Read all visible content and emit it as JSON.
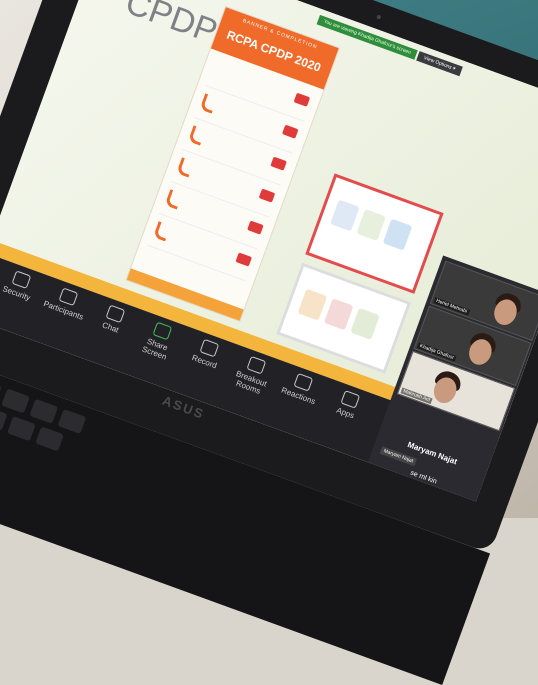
{
  "slide": {
    "title": "CPDP",
    "poster_title": "RCPA CPDP 2020",
    "poster_subtitle": "BANNER & COMPLETION"
  },
  "zoom": {
    "share_banner": "You are viewing Khadija Ghafoor's screen",
    "view_options": "View Options ▾",
    "toolbar": [
      {
        "label": "Security",
        "icon": "shield-icon"
      },
      {
        "label": "Participants",
        "icon": "people-icon"
      },
      {
        "label": "Chat",
        "icon": "chat-icon"
      },
      {
        "label": "Share Screen",
        "icon": "share-icon"
      },
      {
        "label": "Record",
        "icon": "record-icon"
      },
      {
        "label": "Breakout Rooms",
        "icon": "grid-icon"
      },
      {
        "label": "Reactions",
        "icon": "smile-icon"
      },
      {
        "label": "Apps",
        "icon": "apps-icon"
      }
    ],
    "participants": [
      {
        "name": "Heriel Mehrabi"
      },
      {
        "name": "Khadija Ghafoor"
      },
      {
        "name": "Mahrukh Arif"
      }
    ],
    "active_speaker": "Maryam Najat",
    "active_badge": "Maryam Najat",
    "next_label": "se ml kin"
  },
  "laptop": {
    "brand": "ASUS"
  },
  "colors": {
    "accent": "#f06a2a",
    "door": "#3f7f86",
    "toolbar": "#222226",
    "highlight": "#f3b53c"
  }
}
